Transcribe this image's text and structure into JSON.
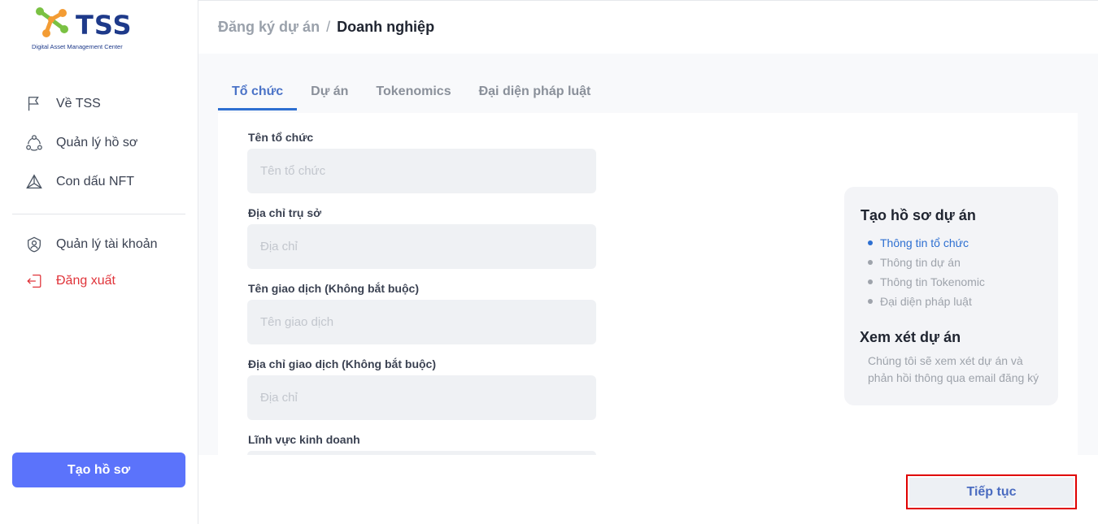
{
  "brand": {
    "name": "TSS",
    "tagline": "Digital Asset Management Center",
    "colors": {
      "primary": "#1e3a8a",
      "orange": "#f39c34",
      "green": "#7ac143"
    }
  },
  "sidebar": {
    "items": [
      {
        "label": "Về TSS",
        "icon": "flag-icon"
      },
      {
        "label": "Quản lý hồ sơ",
        "icon": "network-icon"
      },
      {
        "label": "Con dấu NFT",
        "icon": "triangle-stamp-icon"
      },
      {
        "label": "Quản lý tài khoản",
        "icon": "user-shield-icon"
      },
      {
        "label": "Đăng xuất",
        "icon": "logout-icon"
      }
    ],
    "create_button": "Tạo hồ sơ"
  },
  "breadcrumb": {
    "parent": "Đăng ký dự án",
    "separator": "/",
    "current": "Doanh nghiệp"
  },
  "tabs": [
    {
      "label": "Tổ chức",
      "active": true
    },
    {
      "label": "Dự án",
      "active": false
    },
    {
      "label": "Tokenomics",
      "active": false
    },
    {
      "label": "Đại diện pháp luật",
      "active": false
    }
  ],
  "form": {
    "fields": [
      {
        "label": "Tên tổ chức",
        "placeholder": "Tên tổ chức",
        "value": ""
      },
      {
        "label": "Địa chỉ trụ sở",
        "placeholder": "Địa chỉ",
        "value": ""
      },
      {
        "label": "Tên giao dịch (Không bắt buộc)",
        "placeholder": "Tên giao dịch",
        "value": ""
      },
      {
        "label": "Địa chỉ giao dịch (Không bắt buộc)",
        "placeholder": "Địa chỉ",
        "value": ""
      },
      {
        "label": "Lĩnh vực kinh doanh",
        "placeholder": "",
        "value": ""
      }
    ]
  },
  "steps_panel": {
    "title": "Tạo hồ sơ dự án",
    "steps": [
      {
        "label": "Thông tin tổ chức",
        "active": true
      },
      {
        "label": "Thông tin dự án",
        "active": false
      },
      {
        "label": "Thông tin Tokenomic",
        "active": false
      },
      {
        "label": "Đại diện pháp luật",
        "active": false
      }
    ],
    "review_title": "Xem xét dự án",
    "review_desc": "Chúng tôi sẽ xem xét dự án và phản hồi thông qua email đăng ký"
  },
  "footer": {
    "next_button": "Tiếp tục"
  }
}
